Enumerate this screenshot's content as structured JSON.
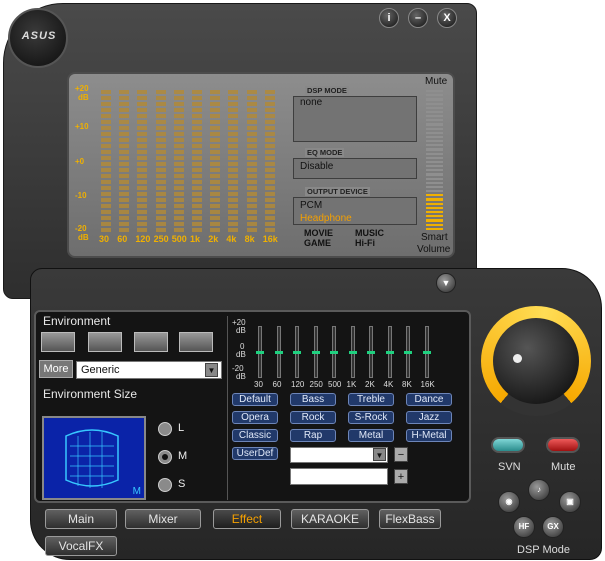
{
  "window": {
    "brand": "ASUS",
    "buttons": {
      "info": "i",
      "minimize": "–",
      "close": "X"
    }
  },
  "eq_display": {
    "db_labels": [
      "+20",
      "dB",
      "+10",
      "+0",
      "-10",
      "-20",
      "dB"
    ],
    "frequencies": [
      "30",
      "60",
      "120",
      "250",
      "500",
      "1k",
      "2k",
      "4k",
      "8k",
      "16k"
    ],
    "levels": [
      1,
      1,
      1,
      1,
      1,
      1,
      1,
      1,
      1,
      1
    ]
  },
  "dsp_mode": {
    "label": "DSP MODE",
    "value": "none"
  },
  "eq_mode": {
    "label": "EQ MODE",
    "value": "Disable"
  },
  "output_device": {
    "label": "OUTPUT DEVICE",
    "value_1": "PCM",
    "value_2": "Headphone"
  },
  "modes": {
    "movie": "MOVIE",
    "music": "MUSIC",
    "game": "GAME",
    "hifi": "Hi-Fi"
  },
  "volume": {
    "mute_label": "Mute",
    "smart_label_1": "Smart",
    "smart_label_2": "Volume",
    "level": 0.25
  },
  "environment": {
    "title": "Environment",
    "more_label": "More",
    "selected": "Generic",
    "size_title": "Environment Size",
    "size_options": [
      "L",
      "M",
      "S"
    ],
    "size_selected": "M",
    "screen_label": "M"
  },
  "equalizer": {
    "db_labels": [
      "+20",
      "dB",
      "0",
      "dB",
      "-20",
      "dB"
    ],
    "frequencies": [
      "30",
      "60",
      "120",
      "250",
      "500",
      "1K",
      "2K",
      "4K",
      "8K",
      "16K"
    ],
    "presets": [
      "Default",
      "Bass",
      "Treble",
      "Dance",
      "Opera",
      "Rock",
      "S-Rock",
      "Jazz",
      "Classic",
      "Rap",
      "Metal",
      "H-Metal"
    ],
    "user_def_label": "UserDef",
    "user_def_select": "",
    "user_def_name": "",
    "minus": "−",
    "plus": "+"
  },
  "tabs": {
    "main": "Main",
    "mixer": "Mixer",
    "effect": "Effect",
    "karaoke": "KARAOKE",
    "flexbass": "FlexBass",
    "vocalfx": "VocalFX"
  },
  "right_panel": {
    "svn_label": "SVN",
    "mute_label": "Mute",
    "dsp_mode_label": "DSP Mode",
    "dsp_buttons": [
      "HF",
      "GX"
    ]
  },
  "colors": {
    "accent": "#f4a000",
    "preset_bg": "#21396a",
    "env_screen": "#0a23a8",
    "svn_pill": "#2a8c8c",
    "mute_pill": "#c02020"
  }
}
